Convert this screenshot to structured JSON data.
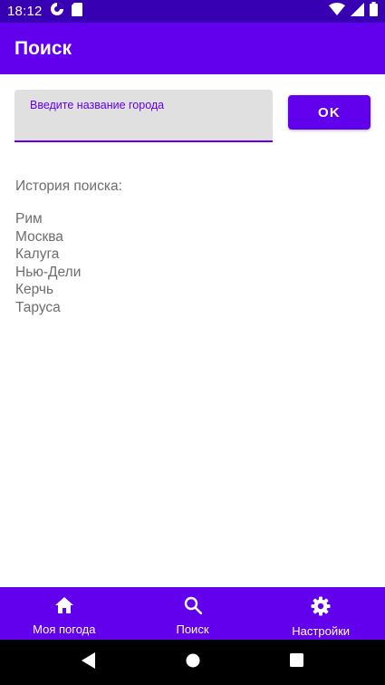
{
  "status_bar": {
    "time": "18:12",
    "left_icons": [
      "data-saver-icon",
      "sd-card-icon"
    ],
    "right_icons": [
      "wifi-icon",
      "signal-icon",
      "battery-icon"
    ]
  },
  "app_bar": {
    "title": "Поиск"
  },
  "search": {
    "label": "Введите название города",
    "value": "",
    "button_label": "OK"
  },
  "history": {
    "title": "История поиска:",
    "items": [
      "Рим",
      "Москва",
      "Калуга",
      "Нью-Дели",
      "Керчь",
      "Таруса"
    ]
  },
  "bottom_nav": {
    "items": [
      {
        "label": "Моя погода",
        "icon": "home-icon"
      },
      {
        "label": "Поиск",
        "icon": "search-icon"
      },
      {
        "label": "Настройки",
        "icon": "gear-icon"
      }
    ]
  },
  "system_nav": {
    "icons": [
      "back-icon",
      "home-circle-icon",
      "recents-icon"
    ]
  },
  "colors": {
    "primary": "#6200ee",
    "primary_dark": "#3700b3",
    "field_background": "#e0e0e0",
    "text_secondary": "#6d6d6d"
  }
}
